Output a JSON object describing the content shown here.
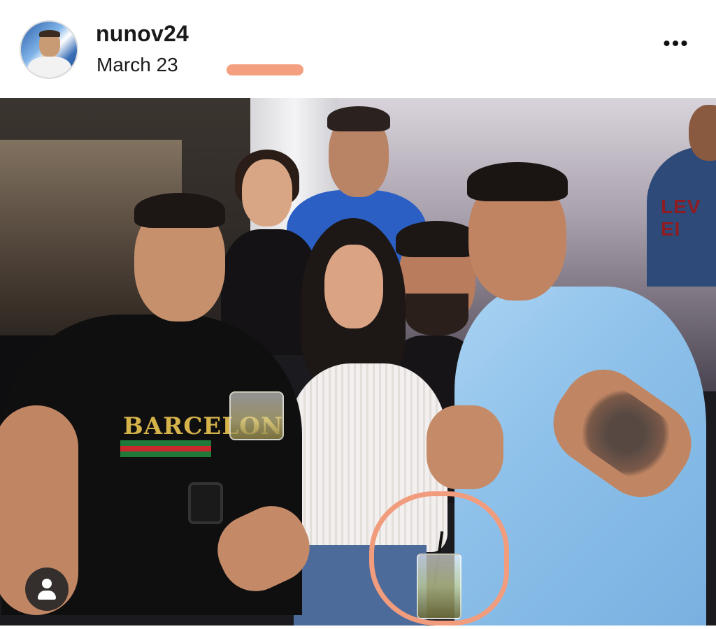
{
  "post": {
    "username": "nunov24",
    "date": "March 23",
    "more_icon": "•••"
  },
  "photo": {
    "shirt_text": "BARCELON",
    "jersey_text": "LEV EI"
  },
  "colors": {
    "annotation": "#f29c7e",
    "redaction": "#f4a080"
  },
  "icons": [
    "more-options-icon",
    "user-tag-icon"
  ]
}
